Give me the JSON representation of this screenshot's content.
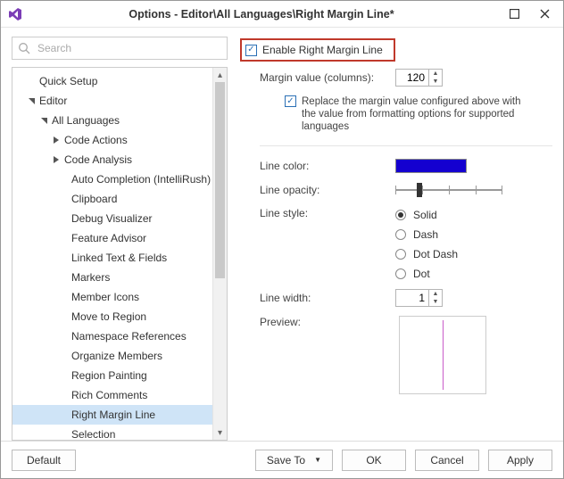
{
  "window": {
    "title": "Options - Editor\\All Languages\\Right Margin Line*"
  },
  "search": {
    "placeholder": "Search"
  },
  "tree": {
    "quick_setup": "Quick Setup",
    "editor": "Editor",
    "all_languages": "All Languages",
    "code_actions": "Code Actions",
    "code_analysis": "Code Analysis",
    "items": {
      "auto_completion": "Auto Completion (IntelliRush)",
      "clipboard": "Clipboard",
      "debug_visualizer": "Debug Visualizer",
      "feature_advisor": "Feature Advisor",
      "linked_text": "Linked Text & Fields",
      "markers": "Markers",
      "member_icons": "Member Icons",
      "move_to_region": "Move to Region",
      "namespace_refs": "Namespace References",
      "organize_members": "Organize Members",
      "region_painting": "Region Painting",
      "rich_comments": "Rich Comments",
      "right_margin_line": "Right Margin Line",
      "selection": "Selection"
    }
  },
  "form": {
    "enable_label": "Enable Right Margin Line",
    "margin_label": "Margin value (columns):",
    "margin_value": "120",
    "replace_text": "Replace the margin value configured above with the value from formatting options for supported languages",
    "line_color_label": "Line color:",
    "line_opacity_label": "Line opacity:",
    "line_style_label": "Line style:",
    "styles": {
      "solid": "Solid",
      "dash": "Dash",
      "dotdash": "Dot Dash",
      "dot": "Dot"
    },
    "line_width_label": "Line width:",
    "line_width_value": "1",
    "preview_label": "Preview:"
  },
  "footer": {
    "default": "Default",
    "save_to": "Save To",
    "ok": "OK",
    "cancel": "Cancel",
    "apply": "Apply"
  }
}
